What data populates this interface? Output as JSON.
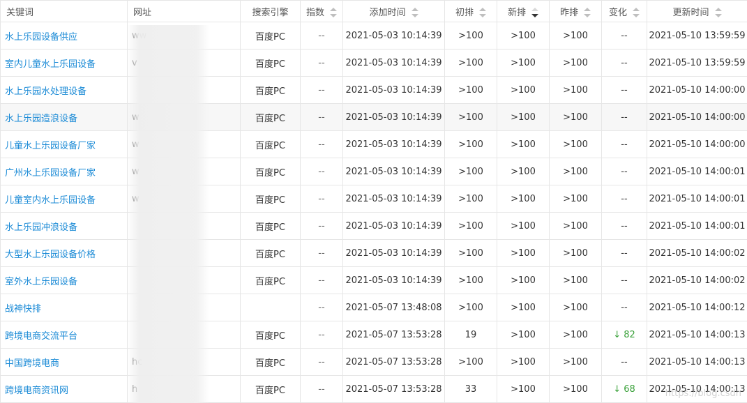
{
  "headers": [
    {
      "label": "关键词",
      "sortable": false
    },
    {
      "label": "网址",
      "sortable": false
    },
    {
      "label": "搜索引擎",
      "sortable": false
    },
    {
      "label": "指数",
      "sortable": true
    },
    {
      "label": "添加时间",
      "sortable": true
    },
    {
      "label": "初排",
      "sortable": true
    },
    {
      "label": "新排",
      "sortable": true,
      "active": true
    },
    {
      "label": "昨排",
      "sortable": true
    },
    {
      "label": "变化",
      "sortable": true
    },
    {
      "label": "更新时间",
      "sortable": true
    }
  ],
  "rows": [
    {
      "keyword": "水上乐园设备供应",
      "url": "ww",
      "engine": "百度PC",
      "index": "--",
      "added": "2021-05-03 10:14:39",
      "first": ">100",
      "new": ">100",
      "yesterday": ">100",
      "change": "--",
      "updated": "2021-05-10 13:59:59"
    },
    {
      "keyword": "室内儿童水上乐园设备",
      "url": "v",
      "engine": "百度PC",
      "index": "--",
      "added": "2021-05-03 10:14:39",
      "first": ">100",
      "new": ">100",
      "yesterday": ">100",
      "change": "--",
      "updated": "2021-05-10 13:59:59"
    },
    {
      "keyword": "水上乐园水处理设备",
      "url": "",
      "engine": "百度PC",
      "index": "--",
      "added": "2021-05-03 10:14:39",
      "first": ">100",
      "new": ">100",
      "yesterday": ">100",
      "change": "--",
      "updated": "2021-05-10 14:00:00"
    },
    {
      "keyword": "水上乐园造浪设备",
      "url": "w",
      "engine": "百度PC",
      "index": "--",
      "added": "2021-05-03 10:14:39",
      "first": ">100",
      "new": ">100",
      "yesterday": ">100",
      "change": "--",
      "updated": "2021-05-10 14:00:00"
    },
    {
      "keyword": "儿童水上乐园设备厂家",
      "url": "w",
      "engine": "百度PC",
      "index": "--",
      "added": "2021-05-03 10:14:39",
      "first": ">100",
      "new": ">100",
      "yesterday": ">100",
      "change": "--",
      "updated": "2021-05-10 14:00:00"
    },
    {
      "keyword": "广州水上乐园设备厂家",
      "url": "w",
      "engine": "百度PC",
      "index": "--",
      "added": "2021-05-03 10:14:39",
      "first": ">100",
      "new": ">100",
      "yesterday": ">100",
      "change": "--",
      "updated": "2021-05-10 14:00:01"
    },
    {
      "keyword": "儿童室内水上乐园设备",
      "url": "w",
      "engine": "百度PC",
      "index": "--",
      "added": "2021-05-03 10:14:39",
      "first": ">100",
      "new": ">100",
      "yesterday": ">100",
      "change": "--",
      "updated": "2021-05-10 14:00:01"
    },
    {
      "keyword": "水上乐园冲浪设备",
      "url": "",
      "engine": "百度PC",
      "index": "--",
      "added": "2021-05-03 10:14:39",
      "first": ">100",
      "new": ">100",
      "yesterday": ">100",
      "change": "--",
      "updated": "2021-05-10 14:00:01"
    },
    {
      "keyword": "大型水上乐园设备价格",
      "url": "",
      "engine": "百度PC",
      "index": "--",
      "added": "2021-05-03 10:14:39",
      "first": ">100",
      "new": ">100",
      "yesterday": ">100",
      "change": "--",
      "updated": "2021-05-10 14:00:02"
    },
    {
      "keyword": "室外水上乐园设备",
      "url": "",
      "engine": "百度PC",
      "index": "--",
      "added": "2021-05-03 10:14:39",
      "first": ">100",
      "new": ">100",
      "yesterday": ">100",
      "change": "--",
      "updated": "2021-05-10 14:00:02"
    },
    {
      "keyword": "战神快排",
      "url": "",
      "engine": "",
      "index": "--",
      "added": "2021-05-07 13:48:08",
      "first": ">100",
      "new": ">100",
      "yesterday": ">100",
      "change": "--",
      "updated": "2021-05-10 14:00:12"
    },
    {
      "keyword": "跨境电商交流平台",
      "url": "",
      "engine": "百度PC",
      "index": "--",
      "added": "2021-05-07 13:53:28",
      "first": "19",
      "new": ">100",
      "yesterday": ">100",
      "change": "↓ 82",
      "updated": "2021-05-10 14:00:13"
    },
    {
      "keyword": "中国跨境电商",
      "url": "hc",
      "engine": "百度PC",
      "index": "--",
      "added": "2021-05-07 13:53:28",
      "first": ">100",
      "new": ">100",
      "yesterday": ">100",
      "change": "--",
      "updated": "2021-05-10 14:00:13"
    },
    {
      "keyword": "跨境电商资讯网",
      "url": "h",
      "engine": "百度PC",
      "index": "--",
      "added": "2021-05-07 13:53:28",
      "first": "33",
      "new": ">100",
      "yesterday": ">100",
      "change": "↓ 68",
      "updated": "2021-05-10 14:00:13"
    }
  ],
  "watermark": "https://blog.csdn",
  "colors": {
    "link": "#1a8ad6",
    "change_down": "#3aa13a",
    "border": "#e6e6e6"
  }
}
